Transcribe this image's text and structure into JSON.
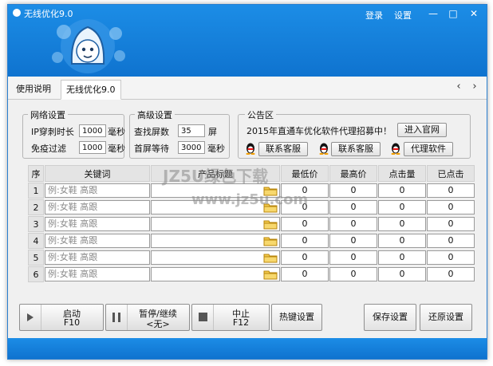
{
  "app": {
    "title": "无线优化9.0",
    "login": "登录",
    "settings": "设置"
  },
  "window_controls": {
    "minimize": "—",
    "maximize": "□",
    "close": "✕"
  },
  "tabs": [
    {
      "label": "使用说明"
    },
    {
      "label": "无线优化9.0"
    }
  ],
  "nav": {
    "prev": "‹",
    "next": "›"
  },
  "network": {
    "legend": "网络设置",
    "ip_label": "IP穿刺时长",
    "ip_value": "1000",
    "ip_unit": "毫秒",
    "filter_label": "免疫过滤",
    "filter_value": "1000",
    "filter_unit": "毫秒"
  },
  "advanced": {
    "legend": "高级设置",
    "search_label": "查找屏数",
    "search_value": "35",
    "search_unit": "屏",
    "wait_label": "首屏等待",
    "wait_value": "3000",
    "wait_unit": "毫秒"
  },
  "notice": {
    "legend": "公告区",
    "text": "2015年直通车优化软件代理招募中！",
    "site_button": "进入官网",
    "service1": "联系客服",
    "service2": "联系客服",
    "agent": "代理软件"
  },
  "table": {
    "headers": [
      "序",
      "关键词",
      "产品标题",
      "最低价",
      "最高价",
      "点击量",
      "已点击"
    ],
    "rows": [
      {
        "n": "1",
        "kw": "例:女鞋 高跟",
        "title": "",
        "min": "0",
        "max": "0",
        "clicks": "0",
        "done": "0"
      },
      {
        "n": "2",
        "kw": "例:女鞋 高跟",
        "title": "",
        "min": "0",
        "max": "0",
        "clicks": "0",
        "done": "0"
      },
      {
        "n": "3",
        "kw": "例:女鞋 高跟",
        "title": "",
        "min": "0",
        "max": "0",
        "clicks": "0",
        "done": "0"
      },
      {
        "n": "4",
        "kw": "例:女鞋 高跟",
        "title": "",
        "min": "0",
        "max": "0",
        "clicks": "0",
        "done": "0"
      },
      {
        "n": "5",
        "kw": "例:女鞋 高跟",
        "title": "",
        "min": "0",
        "max": "0",
        "clicks": "0",
        "done": "0"
      },
      {
        "n": "6",
        "kw": "例:女鞋 高跟",
        "title": "",
        "min": "0",
        "max": "0",
        "clicks": "0",
        "done": "0"
      }
    ]
  },
  "controls": {
    "start": {
      "label": "启动",
      "key": "F10"
    },
    "pause": {
      "label": "暂停/继续",
      "key": "<无>"
    },
    "stop": {
      "label": "中止",
      "key": "F12"
    },
    "hotkey": "热键设置",
    "save": "保存设置",
    "restore": "还原设置"
  },
  "watermark": {
    "line1": "JZ5U绿色下载",
    "line2": "www.jz5u.com"
  },
  "colors": {
    "titlebar": "#1681dc",
    "window_bg": "#f0f0f0"
  }
}
